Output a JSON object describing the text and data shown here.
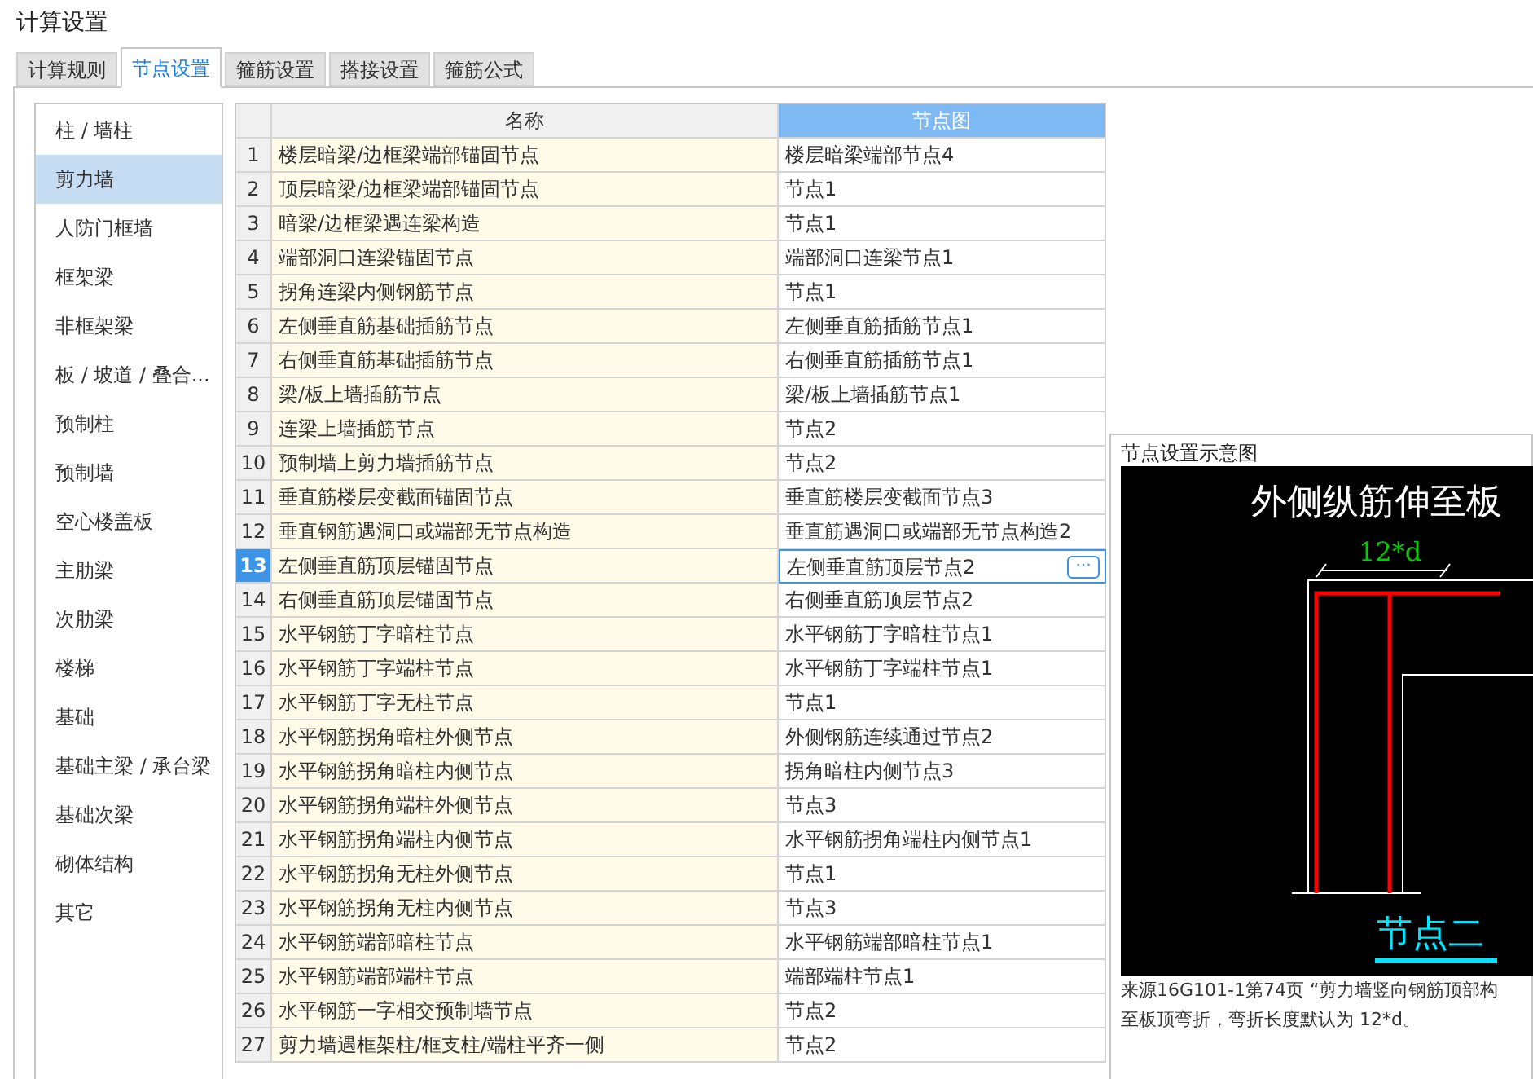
{
  "window": {
    "title": "计算设置"
  },
  "tabs": [
    {
      "label": "计算规则",
      "selected": false
    },
    {
      "label": "节点设置",
      "selected": true
    },
    {
      "label": "箍筋设置",
      "selected": false
    },
    {
      "label": "搭接设置",
      "selected": false
    },
    {
      "label": "箍筋公式",
      "selected": false
    }
  ],
  "sidebar": {
    "items": [
      {
        "label": "柱 / 墙柱",
        "selected": false
      },
      {
        "label": "剪力墙",
        "selected": true
      },
      {
        "label": "人防门框墙",
        "selected": false
      },
      {
        "label": "框架梁",
        "selected": false
      },
      {
        "label": "非框架梁",
        "selected": false
      },
      {
        "label": "板 / 坡道 / 叠合...",
        "selected": false
      },
      {
        "label": "预制柱",
        "selected": false
      },
      {
        "label": "预制墙",
        "selected": false
      },
      {
        "label": "空心楼盖板",
        "selected": false
      },
      {
        "label": "主肋梁",
        "selected": false
      },
      {
        "label": "次肋梁",
        "selected": false
      },
      {
        "label": "楼梯",
        "selected": false
      },
      {
        "label": "基础",
        "selected": false
      },
      {
        "label": "基础主梁 / 承台梁",
        "selected": false
      },
      {
        "label": "基础次梁",
        "selected": false
      },
      {
        "label": "砌体结构",
        "selected": false
      },
      {
        "label": "其它",
        "selected": false
      }
    ]
  },
  "table": {
    "columns": [
      {
        "label": "名称",
        "selected": false
      },
      {
        "label": "节点图",
        "selected": true
      }
    ],
    "rows": [
      {
        "index": "1",
        "name": "楼层暗梁/边框梁端部锚固节点",
        "node": "楼层暗梁端部节点4",
        "selected": false
      },
      {
        "index": "2",
        "name": "顶层暗梁/边框梁端部锚固节点",
        "node": "节点1",
        "selected": false
      },
      {
        "index": "3",
        "name": "暗梁/边框梁遇连梁构造",
        "node": "节点1",
        "selected": false
      },
      {
        "index": "4",
        "name": "端部洞口连梁锚固节点",
        "node": "端部洞口连梁节点1",
        "selected": false
      },
      {
        "index": "5",
        "name": "拐角连梁内侧钢筋节点",
        "node": "节点1",
        "selected": false
      },
      {
        "index": "6",
        "name": "左侧垂直筋基础插筋节点",
        "node": "左侧垂直筋插筋节点1",
        "selected": false
      },
      {
        "index": "7",
        "name": "右侧垂直筋基础插筋节点",
        "node": "右侧垂直筋插筋节点1",
        "selected": false
      },
      {
        "index": "8",
        "name": "梁/板上墙插筋节点",
        "node": "梁/板上墙插筋节点1",
        "selected": false
      },
      {
        "index": "9",
        "name": "连梁上墙插筋节点",
        "node": "节点2",
        "selected": false
      },
      {
        "index": "10",
        "name": "预制墙上剪力墙插筋节点",
        "node": "节点2",
        "selected": false
      },
      {
        "index": "11",
        "name": "垂直筋楼层变截面锚固节点",
        "node": "垂直筋楼层变截面节点3",
        "selected": false
      },
      {
        "index": "12",
        "name": "垂直钢筋遇洞口或端部无节点构造",
        "node": "垂直筋遇洞口或端部无节点构造2",
        "selected": false
      },
      {
        "index": "13",
        "name": "左侧垂直筋顶层锚固节点",
        "node": "左侧垂直筋顶层节点2",
        "selected": true,
        "button": "···"
      },
      {
        "index": "14",
        "name": "右侧垂直筋顶层锚固节点",
        "node": "右侧垂直筋顶层节点2",
        "selected": false
      },
      {
        "index": "15",
        "name": "水平钢筋丁字暗柱节点",
        "node": "水平钢筋丁字暗柱节点1",
        "selected": false
      },
      {
        "index": "16",
        "name": "水平钢筋丁字端柱节点",
        "node": "水平钢筋丁字端柱节点1",
        "selected": false
      },
      {
        "index": "17",
        "name": "水平钢筋丁字无柱节点",
        "node": "节点1",
        "selected": false
      },
      {
        "index": "18",
        "name": "水平钢筋拐角暗柱外侧节点",
        "node": "外侧钢筋连续通过节点2",
        "selected": false
      },
      {
        "index": "19",
        "name": "水平钢筋拐角暗柱内侧节点",
        "node": "拐角暗柱内侧节点3",
        "selected": false
      },
      {
        "index": "20",
        "name": "水平钢筋拐角端柱外侧节点",
        "node": "节点3",
        "selected": false
      },
      {
        "index": "21",
        "name": "水平钢筋拐角端柱内侧节点",
        "node": "水平钢筋拐角端柱内侧节点1",
        "selected": false
      },
      {
        "index": "22",
        "name": "水平钢筋拐角无柱外侧节点",
        "node": "节点1",
        "selected": false
      },
      {
        "index": "23",
        "name": "水平钢筋拐角无柱内侧节点",
        "node": "节点3",
        "selected": false
      },
      {
        "index": "24",
        "name": "水平钢筋端部暗柱节点",
        "node": "水平钢筋端部暗柱节点1",
        "selected": false
      },
      {
        "index": "25",
        "name": "水平钢筋端部端柱节点",
        "node": "端部端柱节点1",
        "selected": false
      },
      {
        "index": "26",
        "name": "水平钢筋一字相交预制墙节点",
        "node": "节点2",
        "selected": false
      },
      {
        "index": "27",
        "name": "剪力墙遇框架柱/框支柱/端柱平齐一侧",
        "node": "节点2",
        "selected": false
      }
    ]
  },
  "preview": {
    "title": "节点设置示意图",
    "diagram": {
      "heading": "外侧纵筋伸至板",
      "dimension": "12*d",
      "caption": "节点二"
    },
    "source_lines": [
      "来源16G101-1第74页 “剪力墙竖向钢筋顶部构",
      "至板顶弯折，弯折长度默认为 12*d。"
    ]
  }
}
